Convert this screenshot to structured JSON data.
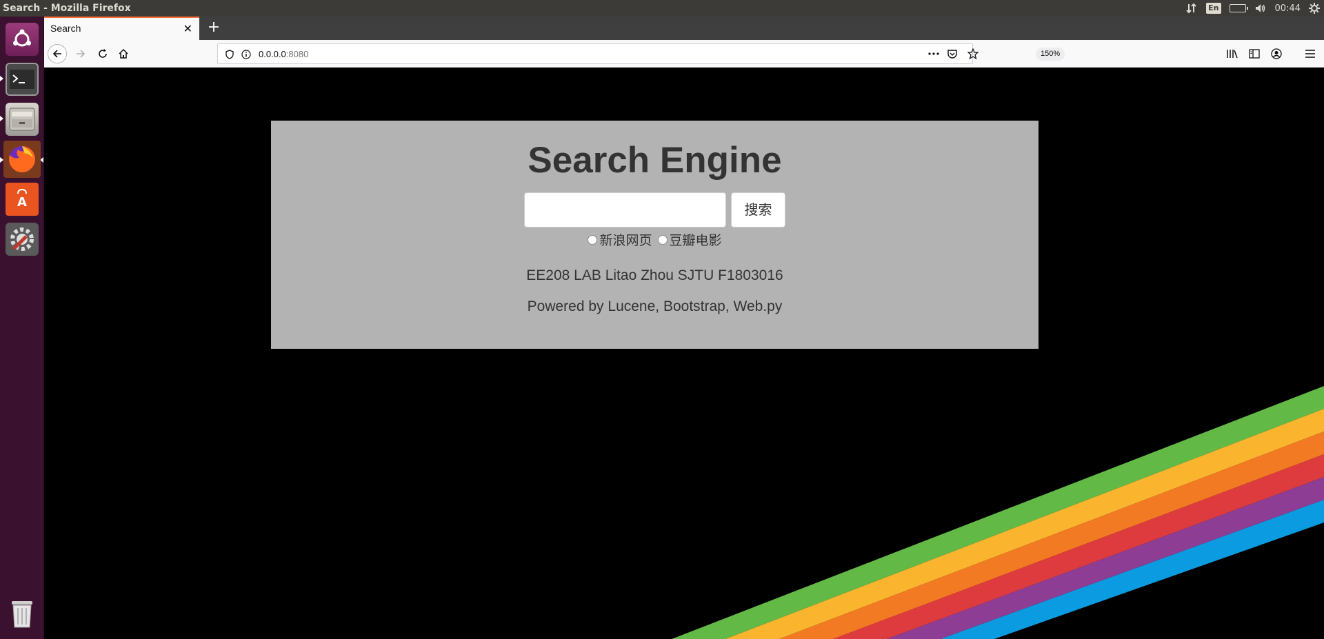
{
  "system": {
    "window_title": "Search - Mozilla Firefox",
    "keyboard_layout": "En",
    "clock": "00:44"
  },
  "launcher": {
    "items": [
      {
        "name": "ubuntu-dash",
        "icon": "ubuntu-logo-icon"
      },
      {
        "name": "terminal",
        "icon": "terminal-icon"
      },
      {
        "name": "files",
        "icon": "file-cabinet-icon"
      },
      {
        "name": "firefox",
        "icon": "firefox-icon"
      },
      {
        "name": "software",
        "icon": "software-bag-icon"
      },
      {
        "name": "system-settings",
        "icon": "settings-wrench-icon"
      },
      {
        "name": "trash",
        "icon": "trash-icon"
      }
    ]
  },
  "browser": {
    "tab_title": "Search",
    "url_host": "0.0.0.0",
    "url_port": ":8080",
    "zoom": "150%"
  },
  "page": {
    "title": "Search Engine",
    "search_value": "",
    "search_button": "搜索",
    "radio_options": [
      {
        "label": "新浪网页",
        "checked": false
      },
      {
        "label": "豆瓣电影",
        "checked": false
      }
    ],
    "credit_line": "EE208 LAB Litao Zhou SJTU F1803016",
    "powered_line": "Powered by Lucene, Bootstrap, Web.py"
  },
  "colors": {
    "panel_bg": "#b3b3b3",
    "rainbow": [
      "#63b946",
      "#fbb42e",
      "#f27a23",
      "#de3b3f",
      "#8e3d94",
      "#0b9be0"
    ]
  }
}
